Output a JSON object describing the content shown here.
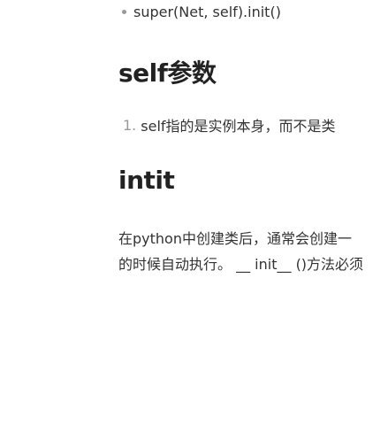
{
  "bullets": [
    {
      "text": "super(Net, self).init()"
    }
  ],
  "sections": [
    {
      "title": "self参数",
      "list": [
        {
          "number": "1.",
          "text": "self指的是实例本身，而不是类"
        }
      ]
    },
    {
      "title": "intit",
      "paragraph_lines": [
        "在python中创建类后，通常会创建一",
        "的时候自动执行。  __ init__ ()方法必须"
      ]
    }
  ]
}
